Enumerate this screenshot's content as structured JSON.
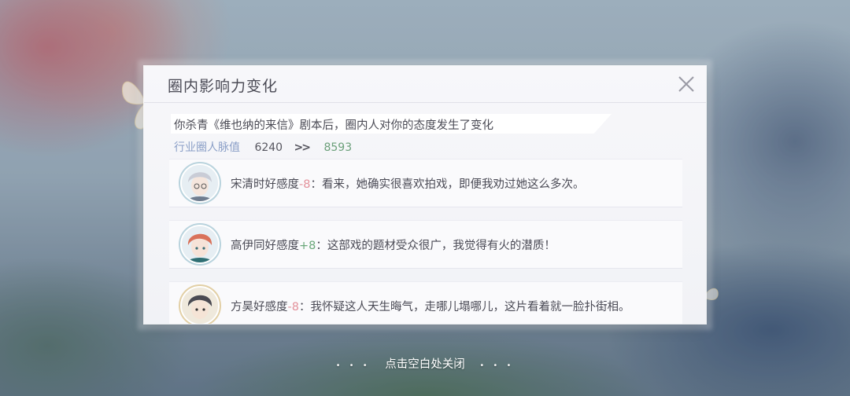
{
  "dialog": {
    "title": "圈内影响力变化",
    "subtitle": "你杀青《维也纳的来信》剧本后，圈内人对你的态度发生了变化",
    "metric": {
      "label": "行业圈人脉值",
      "old_value": "6240",
      "arrow": ">>",
      "new_value": "8593"
    },
    "items": [
      {
        "name": "宋清时好感度",
        "delta": "-8",
        "delta_type": "negative",
        "sep": "：",
        "quote": "看来，她确实很喜欢拍戏，即便我劝过她这么多次。"
      },
      {
        "name": "高伊同好感度",
        "delta": "+8",
        "delta_type": "positive",
        "sep": "：",
        "quote": "这部戏的题材受众很广，我觉得有火的潜质！"
      },
      {
        "name": "方昊好感度",
        "delta": "-8",
        "delta_type": "negative",
        "sep": "：",
        "quote": "我怀疑这人天生晦气，走哪儿塌哪儿，这片看着就一脸扑街相。"
      }
    ]
  },
  "footer": {
    "hint": "点击空白处关闭",
    "dots_left": "• • •",
    "dots_right": "• • •"
  },
  "colors": {
    "positive": "#6aa77a",
    "negative": "#e3919b",
    "label_blue": "#8a9fc7"
  },
  "icons": [
    "close-icon",
    "avatar-song",
    "avatar-gao",
    "avatar-fang",
    "butterfly-icon"
  ]
}
